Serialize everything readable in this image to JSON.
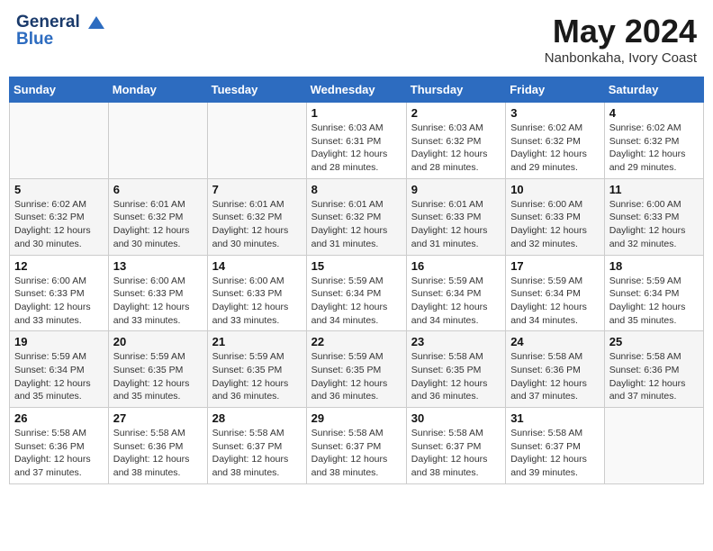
{
  "header": {
    "logo_line1": "General",
    "logo_line2": "Blue",
    "month_title": "May 2024",
    "location": "Nanbonkaha, Ivory Coast"
  },
  "days_of_week": [
    "Sunday",
    "Monday",
    "Tuesday",
    "Wednesday",
    "Thursday",
    "Friday",
    "Saturday"
  ],
  "weeks": [
    [
      {
        "day": "",
        "info": ""
      },
      {
        "day": "",
        "info": ""
      },
      {
        "day": "",
        "info": ""
      },
      {
        "day": "1",
        "info": "Sunrise: 6:03 AM\nSunset: 6:31 PM\nDaylight: 12 hours\nand 28 minutes."
      },
      {
        "day": "2",
        "info": "Sunrise: 6:03 AM\nSunset: 6:32 PM\nDaylight: 12 hours\nand 28 minutes."
      },
      {
        "day": "3",
        "info": "Sunrise: 6:02 AM\nSunset: 6:32 PM\nDaylight: 12 hours\nand 29 minutes."
      },
      {
        "day": "4",
        "info": "Sunrise: 6:02 AM\nSunset: 6:32 PM\nDaylight: 12 hours\nand 29 minutes."
      }
    ],
    [
      {
        "day": "5",
        "info": "Sunrise: 6:02 AM\nSunset: 6:32 PM\nDaylight: 12 hours\nand 30 minutes."
      },
      {
        "day": "6",
        "info": "Sunrise: 6:01 AM\nSunset: 6:32 PM\nDaylight: 12 hours\nand 30 minutes."
      },
      {
        "day": "7",
        "info": "Sunrise: 6:01 AM\nSunset: 6:32 PM\nDaylight: 12 hours\nand 30 minutes."
      },
      {
        "day": "8",
        "info": "Sunrise: 6:01 AM\nSunset: 6:32 PM\nDaylight: 12 hours\nand 31 minutes."
      },
      {
        "day": "9",
        "info": "Sunrise: 6:01 AM\nSunset: 6:33 PM\nDaylight: 12 hours\nand 31 minutes."
      },
      {
        "day": "10",
        "info": "Sunrise: 6:00 AM\nSunset: 6:33 PM\nDaylight: 12 hours\nand 32 minutes."
      },
      {
        "day": "11",
        "info": "Sunrise: 6:00 AM\nSunset: 6:33 PM\nDaylight: 12 hours\nand 32 minutes."
      }
    ],
    [
      {
        "day": "12",
        "info": "Sunrise: 6:00 AM\nSunset: 6:33 PM\nDaylight: 12 hours\nand 33 minutes."
      },
      {
        "day": "13",
        "info": "Sunrise: 6:00 AM\nSunset: 6:33 PM\nDaylight: 12 hours\nand 33 minutes."
      },
      {
        "day": "14",
        "info": "Sunrise: 6:00 AM\nSunset: 6:33 PM\nDaylight: 12 hours\nand 33 minutes."
      },
      {
        "day": "15",
        "info": "Sunrise: 5:59 AM\nSunset: 6:34 PM\nDaylight: 12 hours\nand 34 minutes."
      },
      {
        "day": "16",
        "info": "Sunrise: 5:59 AM\nSunset: 6:34 PM\nDaylight: 12 hours\nand 34 minutes."
      },
      {
        "day": "17",
        "info": "Sunrise: 5:59 AM\nSunset: 6:34 PM\nDaylight: 12 hours\nand 34 minutes."
      },
      {
        "day": "18",
        "info": "Sunrise: 5:59 AM\nSunset: 6:34 PM\nDaylight: 12 hours\nand 35 minutes."
      }
    ],
    [
      {
        "day": "19",
        "info": "Sunrise: 5:59 AM\nSunset: 6:34 PM\nDaylight: 12 hours\nand 35 minutes."
      },
      {
        "day": "20",
        "info": "Sunrise: 5:59 AM\nSunset: 6:35 PM\nDaylight: 12 hours\nand 35 minutes."
      },
      {
        "day": "21",
        "info": "Sunrise: 5:59 AM\nSunset: 6:35 PM\nDaylight: 12 hours\nand 36 minutes."
      },
      {
        "day": "22",
        "info": "Sunrise: 5:59 AM\nSunset: 6:35 PM\nDaylight: 12 hours\nand 36 minutes."
      },
      {
        "day": "23",
        "info": "Sunrise: 5:58 AM\nSunset: 6:35 PM\nDaylight: 12 hours\nand 36 minutes."
      },
      {
        "day": "24",
        "info": "Sunrise: 5:58 AM\nSunset: 6:36 PM\nDaylight: 12 hours\nand 37 minutes."
      },
      {
        "day": "25",
        "info": "Sunrise: 5:58 AM\nSunset: 6:36 PM\nDaylight: 12 hours\nand 37 minutes."
      }
    ],
    [
      {
        "day": "26",
        "info": "Sunrise: 5:58 AM\nSunset: 6:36 PM\nDaylight: 12 hours\nand 37 minutes."
      },
      {
        "day": "27",
        "info": "Sunrise: 5:58 AM\nSunset: 6:36 PM\nDaylight: 12 hours\nand 38 minutes."
      },
      {
        "day": "28",
        "info": "Sunrise: 5:58 AM\nSunset: 6:37 PM\nDaylight: 12 hours\nand 38 minutes."
      },
      {
        "day": "29",
        "info": "Sunrise: 5:58 AM\nSunset: 6:37 PM\nDaylight: 12 hours\nand 38 minutes."
      },
      {
        "day": "30",
        "info": "Sunrise: 5:58 AM\nSunset: 6:37 PM\nDaylight: 12 hours\nand 38 minutes."
      },
      {
        "day": "31",
        "info": "Sunrise: 5:58 AM\nSunset: 6:37 PM\nDaylight: 12 hours\nand 39 minutes."
      },
      {
        "day": "",
        "info": ""
      }
    ]
  ]
}
